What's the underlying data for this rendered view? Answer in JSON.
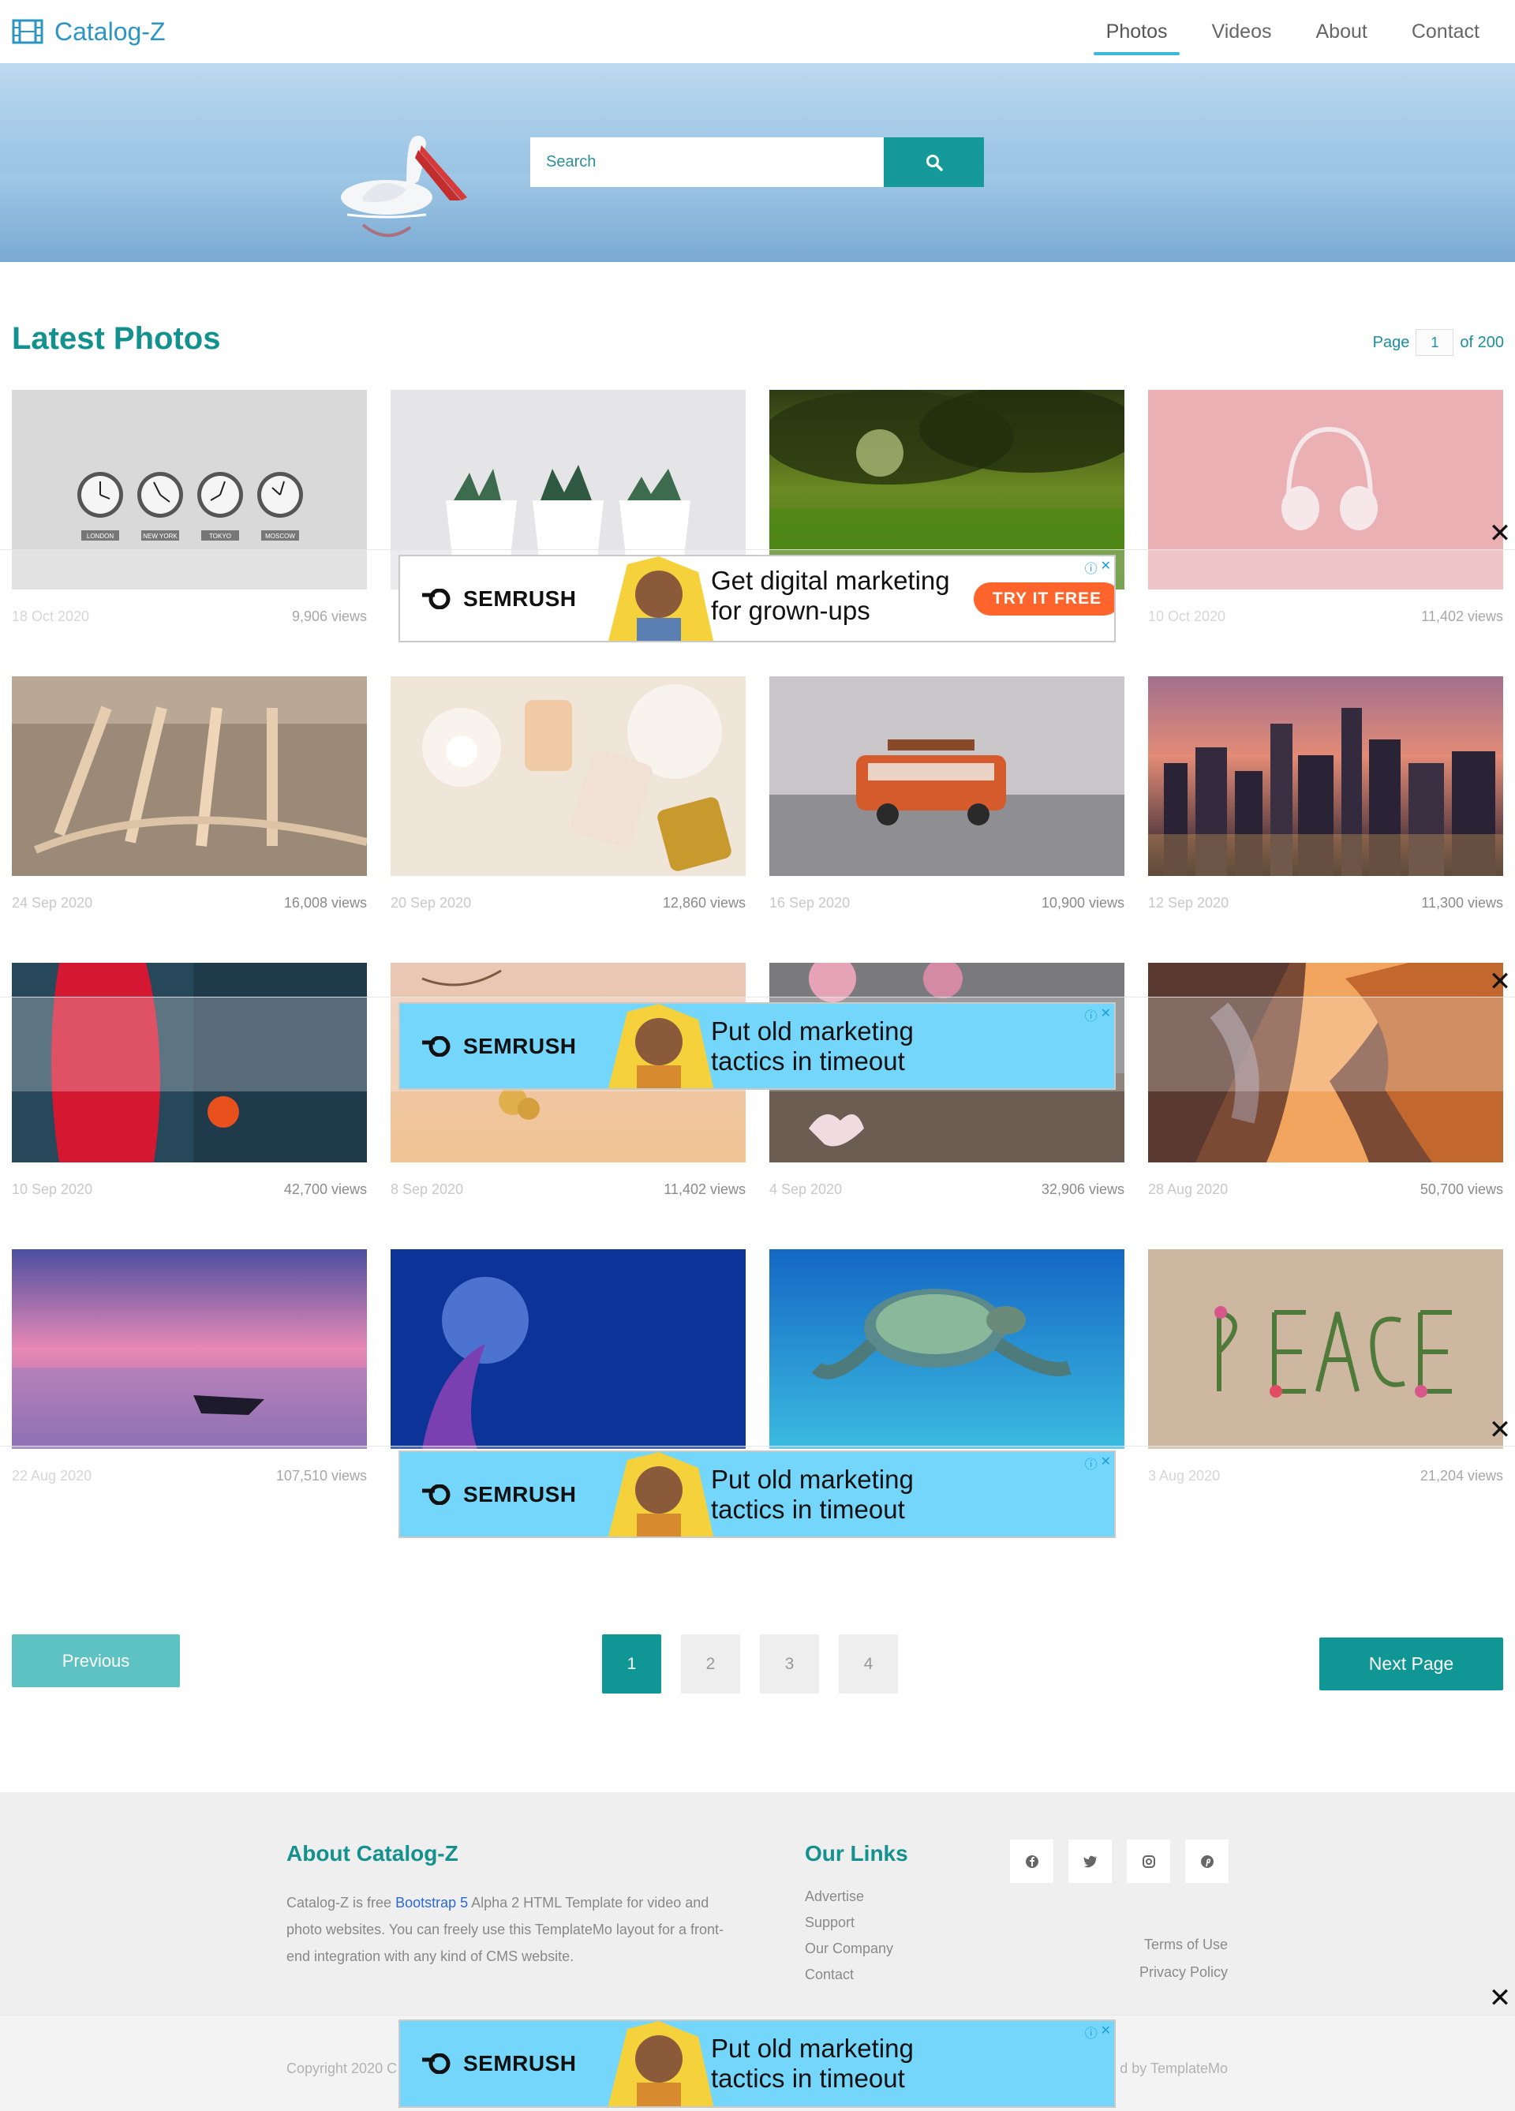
{
  "navbar": {
    "brand": "Catalog-Z",
    "links": [
      "Photos",
      "Videos",
      "About",
      "Contact"
    ],
    "active": "Photos"
  },
  "hero": {
    "search_placeholder": "Search",
    "search_icon": "search-icon"
  },
  "section": {
    "title": "Latest Photos",
    "page_label": "Page",
    "page_current": "1",
    "page_total_label": "of 200"
  },
  "photos": [
    {
      "date": "18 Oct 2020",
      "views": "9,906 views"
    },
    {
      "date": "",
      "views": ""
    },
    {
      "date": "",
      "views": ""
    },
    {
      "date": "10 Oct 2020",
      "views": "11,402 views"
    },
    {
      "date": "24 Sep 2020",
      "views": "16,008 views"
    },
    {
      "date": "20 Sep 2020",
      "views": "12,860 views"
    },
    {
      "date": "16 Sep 2020",
      "views": "10,900 views"
    },
    {
      "date": "12 Sep 2020",
      "views": "11,300 views"
    },
    {
      "date": "10 Sep 2020",
      "views": "42,700 views"
    },
    {
      "date": "8 Sep 2020",
      "views": "11,402 views"
    },
    {
      "date": "4 Sep 2020",
      "views": "32,906 views"
    },
    {
      "date": "28 Aug 2020",
      "views": "50,700 views"
    },
    {
      "date": "22 Aug 2020",
      "views": "107,510 views"
    },
    {
      "date": "",
      "views": ""
    },
    {
      "date": "",
      "views": ""
    },
    {
      "date": "3 Aug 2020",
      "views": "21,204 views"
    }
  ],
  "clock_labels": [
    "LONDON",
    "NEW YORK",
    "TOKYO",
    "MOSCOW"
  ],
  "ads": [
    {
      "brand": "SEMRUSH",
      "copy_line1": "Get digital marketing",
      "copy_line2": "for grown-ups",
      "cta": "TRY IT FREE"
    },
    {
      "brand": "SEMRUSH",
      "copy_line1": "Put old marketing",
      "copy_line2": "tactics in timeout"
    },
    {
      "brand": "SEMRUSH",
      "copy_line1": "Put old marketing",
      "copy_line2": "tactics in timeout"
    },
    {
      "brand": "SEMRUSH",
      "copy_line1": "Put old marketing",
      "copy_line2": "tactics in timeout"
    }
  ],
  "ad_close": "✕",
  "ad_badges": [
    "ⓘ",
    "✕"
  ],
  "pagination": {
    "previous": "Previous",
    "pages": [
      "1",
      "2",
      "3",
      "4"
    ],
    "next": "Next Page"
  },
  "footer": {
    "about_title": "About Catalog-Z",
    "about_text_pre": "Catalog-Z is free ",
    "about_link": "Bootstrap 5",
    "about_text_post": " Alpha 2 HTML Template for video and photo websites. You can freely use this TemplateMo layout for a front-end integration with any kind of CMS website.",
    "links_title": "Our Links",
    "links": [
      "Advertise",
      "Support",
      "Our Company",
      "Contact"
    ],
    "social": [
      "facebook-icon",
      "twitter-icon",
      "instagram-icon",
      "pinterest-icon"
    ],
    "legal": [
      "Terms of Use",
      "Privacy Policy"
    ],
    "copyright": "Copyright 2020 C",
    "credit": "d by TemplateMo"
  },
  "colors": {
    "brand": "#2c95c4",
    "accent": "#0f9695",
    "nav_active": "#3bb6df",
    "ad_blue": "#74d6fb",
    "ad_cta": "#ff642d"
  }
}
